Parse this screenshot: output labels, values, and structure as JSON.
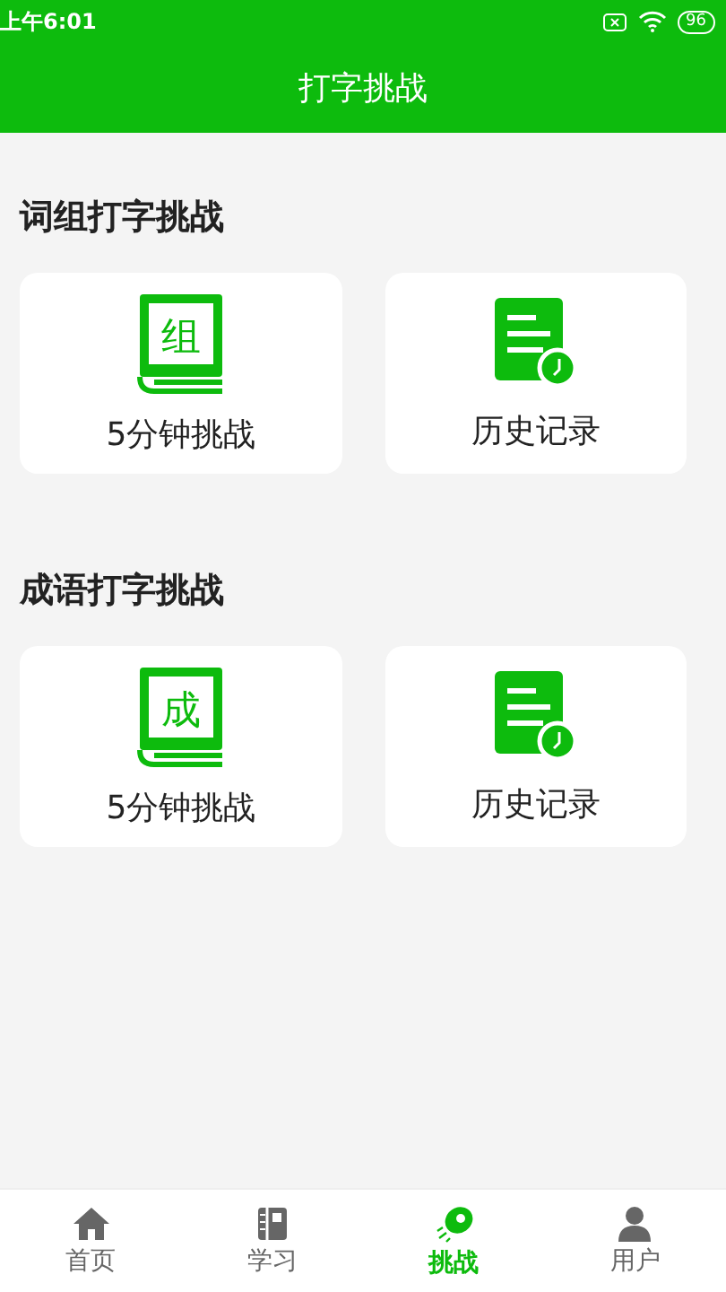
{
  "status_bar": {
    "time": "上午6:01",
    "battery": "96"
  },
  "header": {
    "title": "打字挑战"
  },
  "sections": [
    {
      "title": "词组打字挑战",
      "cards": [
        {
          "kind": "book",
          "icon_char": "组",
          "label": "5分钟挑战"
        },
        {
          "kind": "history",
          "label": "历史记录"
        }
      ]
    },
    {
      "title": "成语打字挑战",
      "cards": [
        {
          "kind": "book",
          "icon_char": "成",
          "label": "5分钟挑战"
        },
        {
          "kind": "history",
          "label": "历史记录"
        }
      ]
    }
  ],
  "tabs": [
    {
      "kind": "home",
      "label": "首页",
      "selected": false
    },
    {
      "kind": "study",
      "label": "学习",
      "selected": false
    },
    {
      "kind": "challenge",
      "label": "挑战",
      "selected": true
    },
    {
      "kind": "user",
      "label": "用户",
      "selected": false
    }
  ]
}
